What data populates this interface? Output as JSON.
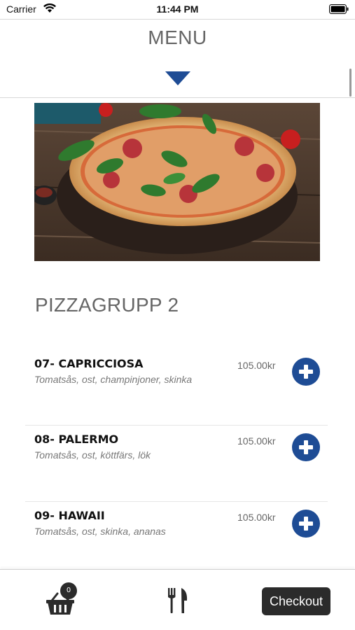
{
  "status": {
    "carrier": "Carrier",
    "time": "11:44 PM"
  },
  "header": {
    "title": "MENU"
  },
  "group": {
    "title": "PIZZAGRUPP 2"
  },
  "items": [
    {
      "name": "07- CAPRICCIOSA",
      "description": "Tomatsås, ost, champinjoner, skinka",
      "price": "105.00kr"
    },
    {
      "name": "08- PALERMO",
      "description": "Tomatsås, ost, köttfärs, lök",
      "price": "105.00kr"
    },
    {
      "name": "09- HAWAII",
      "description": "Tomatsås, ost, skinka, ananas",
      "price": "105.00kr"
    }
  ],
  "bottom_bar": {
    "cart_count": "0",
    "checkout_label": "Checkout",
    "cart_icon": "basket-icon",
    "menu_icon": "fork-knife-icon"
  },
  "colors": {
    "accent": "#1e4c95",
    "dark_button": "#2b2b2b",
    "header_text": "#666666"
  }
}
